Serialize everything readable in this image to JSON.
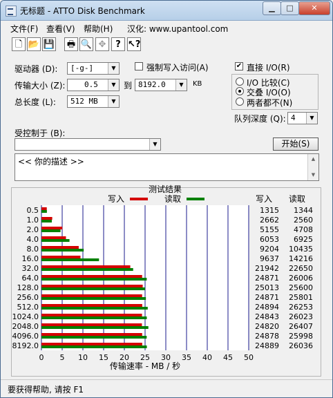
{
  "window": {
    "title": "无标题 - ATTO Disk Benchmark"
  },
  "menu": {
    "file": "文件(F)",
    "view": "查看(V)",
    "help": "帮助(H)",
    "localized": "汉化: www.upantool.com"
  },
  "toolbar": {
    "icons": [
      "new-document-icon",
      "open-folder-icon",
      "save-disk-icon",
      "print-icon",
      "print-preview-icon",
      "move-icon",
      "help-icon",
      "context-help-icon"
    ]
  },
  "form": {
    "drive_label": "驱动器 (D):",
    "drive_value": "[-g-]",
    "force_write_label": "强制写入访问(A)",
    "force_write_checked": false,
    "transfer_label": "传输大小 (Z):",
    "transfer_from": "0.5",
    "to_label": "到",
    "transfer_to": "8192.0",
    "kb_unit": "KB",
    "total_length_label": "总长度 (L):",
    "total_length_value": "512 MB",
    "direct_io_label": "直接 I/O(R)",
    "direct_io_checked": true,
    "io_compare_label": "I/O 比较(C)",
    "overlapped_io_label": "交叠 I/O(O)",
    "neither_label": "两者都不(N)",
    "queue_depth_label": "队列深度 (Q):",
    "queue_depth_value": "4",
    "controlled_by_label": "受控制于 (B):",
    "controlled_by_value": "",
    "start_button": "开始(S)",
    "description_text": "<<  你的描述   >>"
  },
  "status": {
    "text": "要获得帮助, 请按 F1"
  },
  "chart_data": {
    "type": "bar",
    "title": "测试结果",
    "legend": {
      "write": "写入",
      "read": "读取",
      "placement": "top"
    },
    "write_header": "写入",
    "read_header": "读取",
    "categories": [
      "0.5",
      "1.0",
      "2.0",
      "4.0",
      "8.0",
      "16.0",
      "32.0",
      "64.0",
      "128.0",
      "256.0",
      "512.0",
      "1024.0",
      "2048.0",
      "4096.0",
      "8192.0"
    ],
    "series": [
      {
        "name": "写入",
        "color": "#d40000",
        "values": [
          1315,
          2662,
          5155,
          6053,
          9204,
          9637,
          21942,
          24871,
          25013,
          24871,
          24894,
          24843,
          24820,
          24878,
          24889
        ]
      },
      {
        "name": "读取",
        "color": "#008000",
        "values": [
          1344,
          2560,
          4708,
          6925,
          10435,
          14216,
          22650,
          26006,
          25600,
          25801,
          26253,
          26023,
          26407,
          25998,
          26036
        ]
      }
    ],
    "xlabel": "传输速率 - MB / 秒",
    "xticks": [
      "0",
      "5",
      "10",
      "15",
      "20",
      "25",
      "30",
      "35",
      "40",
      "45",
      "50"
    ],
    "xlim": [
      0,
      50
    ],
    "grid": true
  }
}
